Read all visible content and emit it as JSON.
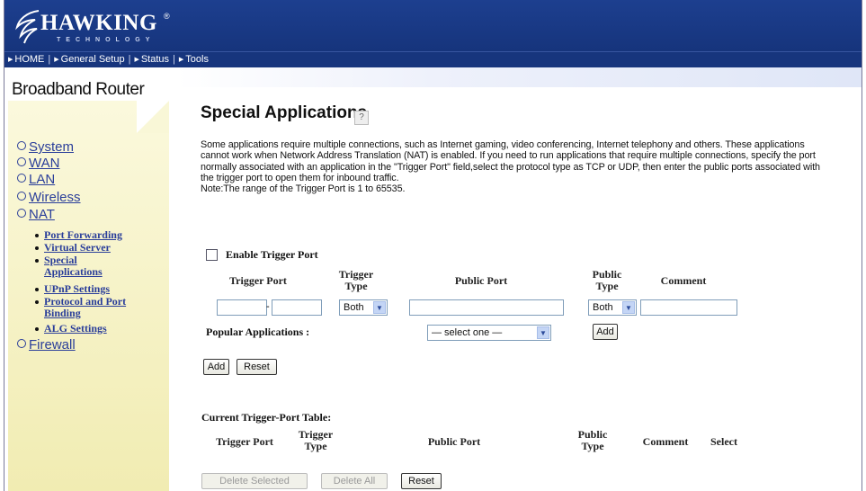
{
  "brand": {
    "logo_text": "HAWKING",
    "logo_sub": "TECHNOLOGY",
    "reg_mark": "®",
    "product": "Broadband Router"
  },
  "nav": [
    {
      "label": "HOME"
    },
    {
      "label": "General Setup"
    },
    {
      "label": "Status"
    },
    {
      "label": "Tools"
    }
  ],
  "sidebar": {
    "main": [
      "System",
      "WAN",
      "LAN",
      "Wireless",
      "NAT"
    ],
    "nat_sub": [
      "Port Forwarding",
      "Virtual Server",
      "Special Applications",
      "UPnP Settings",
      "Protocol and Port Binding",
      "ALG Settings"
    ],
    "firewall": "Firewall"
  },
  "page": {
    "title": "Special Applications",
    "help_icon": "help-icon",
    "description": "Some applications require multiple connections, such as Internet gaming, video conferencing, Internet telephony and others. These applications cannot work when Network Address Translation (NAT) is enabled. If you need to run applications that require multiple connections, specify the port normally associated with an application in the \"Trigger Port\" field,select the protocol type as TCP or UDP, then enter the public ports associated with the trigger port to open them for inbound traffic.",
    "note": "Note:The range of the Trigger Port is 1 to 65535."
  },
  "form": {
    "enable_label": "Enable Trigger Port",
    "enable_checked": false,
    "headers": {
      "trigger_port": "Trigger Port",
      "trigger_type_1": "Trigger",
      "trigger_type_2": "Type",
      "public_port": "Public Port",
      "public_type_1": "Public",
      "public_type_2": "Type",
      "comment": "Comment"
    },
    "trigger_type_value": "Both",
    "public_type_value": "Both",
    "port_separator": "-",
    "popular_label": "Popular Applications :",
    "popular_value": "— select one —",
    "add_label": "Add",
    "add_label_2": "Add",
    "reset_label": "Reset"
  },
  "table": {
    "caption": "Current Trigger-Port Table:",
    "headers": {
      "trigger_port": "Trigger Port",
      "trigger_type_1": "Trigger",
      "trigger_type_2": "Type",
      "public_port": "Public Port",
      "public_type_1": "Public",
      "public_type_2": "Type",
      "comment": "Comment",
      "select": "Select"
    },
    "delete_selected": "Delete Selected",
    "delete_all": "Delete All",
    "reset": "Reset"
  },
  "colors": {
    "header": "#1a3a88",
    "sidebar": "#f3efb8",
    "link": "#2a3e9a"
  }
}
